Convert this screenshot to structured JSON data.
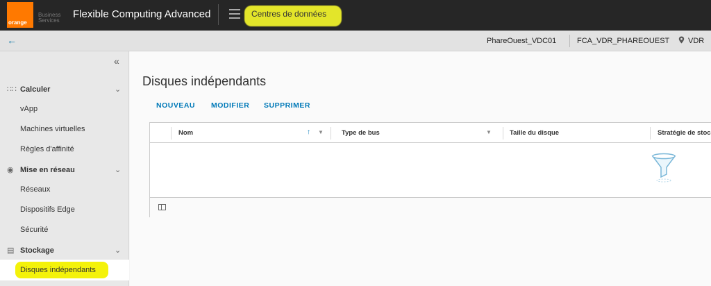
{
  "header": {
    "logo_text": "orange",
    "logo_sub1": "Business",
    "logo_sub2": "Services",
    "app_title": "Flexible Computing Advanced",
    "nav_label": "Centres de données"
  },
  "context": {
    "vdc": "PhareOuest_VDC01",
    "org": "FCA_VDR_PHAREOUEST",
    "location": "VDR"
  },
  "sidebar": {
    "groups": [
      {
        "label": "Calculer",
        "icon": "grid-icon",
        "items": [
          "vApp",
          "Machines virtuelles",
          "Règles d'affinité"
        ]
      },
      {
        "label": "Mise en réseau",
        "icon": "network-icon",
        "items": [
          "Réseaux",
          "Dispositifs Edge",
          "Sécurité"
        ]
      },
      {
        "label": "Stockage",
        "icon": "storage-icon",
        "items": [
          "Disques indépendants"
        ]
      }
    ],
    "active_item": "Disques indépendants"
  },
  "main": {
    "title": "Disques indépendants",
    "actions": [
      "NOUVEAU",
      "MODIFIER",
      "SUPPRIMER"
    ],
    "columns": [
      "Nom",
      "Type de bus",
      "Taille du disque",
      "Stratégie de stoc"
    ]
  },
  "colors": {
    "header_bg": "#262626",
    "brand_orange": "#ff7900",
    "action_blue": "#0079b8",
    "highlight": "#f4f20a"
  }
}
